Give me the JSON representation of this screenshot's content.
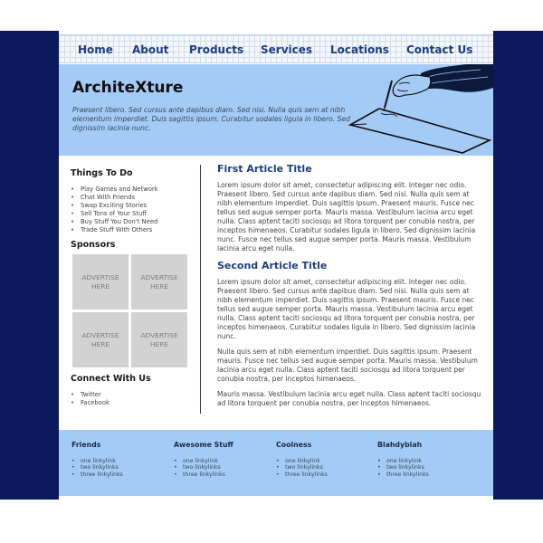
{
  "nav": {
    "items": [
      {
        "label": "Home"
      },
      {
        "label": "About"
      },
      {
        "label": "Products"
      },
      {
        "label": "Services"
      },
      {
        "label": "Locations"
      },
      {
        "label": "Contact Us"
      }
    ]
  },
  "header": {
    "title": "ArchiteXture",
    "tagline": "Praesent libero. Sed cursus ante dapibus diam. Sed nisi. Nulla quis sem at nibh elementum imperdiet. Duis sagittis ipsum. Curabitur sodales ligula in libero. Sed dignissim lacinia nunc."
  },
  "sidebar": {
    "things_heading": "Things To Do",
    "things": [
      "Play Games and Network",
      "Chat With Friends",
      "Swap Exciting Stories",
      "Sell Tons of Your Stuff",
      "Buy Stuff You Don't Need",
      "Trade Stuff With Others"
    ],
    "sponsors_heading": "Sponsors",
    "ads": [
      {
        "line1": "ADVERTISE",
        "line2": "HERE"
      },
      {
        "line1": "ADVERTISE",
        "line2": "HERE"
      },
      {
        "line1": "ADVERTISE",
        "line2": "HERE"
      },
      {
        "line1": "ADVERTISE",
        "line2": "HERE"
      }
    ],
    "connect_heading": "Connect With Us",
    "connect": [
      "Twitter",
      "Facebook"
    ]
  },
  "main": {
    "first_title": "First Article Title",
    "first_p1": "Lorem ipsum dolor sit amet, consectetur adipiscing elit. Integer nec odio. Praesent libero. Sed cursus ante dapibus diam. Sed nisi. Nulla quis sem at nibh elementum imperdiet. Duis sagittis ipsum. Praesent mauris. Fusce nec tellus sed augue semper porta. Mauris massa. Vestibulum lacinia arcu eget nulla. Class aptent taciti sociosqu ad litora torquent per conubia nostra, per inceptos himenaeos. Curabitur sodales ligula in libero. Sed dignissim lacinia nunc. Fusce nec tellus sed augue semper porta. Mauris massa. Vestibulum lacinia arcu eget nulla.",
    "second_title": "Second Article Title",
    "second_p1": "Lorem ipsum dolor sit amet, consectetur adipiscing elit. Integer nec odio. Praesent libero. Sed cursus ante dapibus diam. Sed nisi. Nulla quis sem at nibh elementum imperdiet. Duis sagittis ipsum. Praesent mauris. Fusce nec tellus sed augue semper porta. Mauris massa. Vestibulum lacinia arcu eget nulla. Class aptent taciti sociosqu ad litora torquent per conubia nostra, per inceptos himenaeos. Curabitur sodales ligula in libero. Sed dignissim lacinia nunc.",
    "second_p2": "Nulla quis sem at nibh elementum imperdiet. Duis sagittis ipsum. Praesent mauris. Fusce nec tellus sed augue semper porta. Mauris massa. Vestibulum lacinia arcu eget nulla. Class aptent taciti sociosqu ad litora torquent per conubia nostra, per inceptos himenaeos.",
    "second_p3": "Mauris massa. Vestibulum lacinia arcu eget nulla. Class aptent taciti sociosqu ad litora torquent per conubia nostra, per inceptos himenaeos."
  },
  "footer": {
    "columns": [
      {
        "heading": "Friends",
        "links": [
          "one linkylink",
          "two linkylinks",
          "three linkylinks"
        ]
      },
      {
        "heading": "Awesome Stuff",
        "links": [
          "one linkylink",
          "two linkylinks",
          "three linkylinks"
        ]
      },
      {
        "heading": "Coolness",
        "links": [
          "one linkylink",
          "two linkylinks",
          "three linkylinks"
        ]
      },
      {
        "heading": "Blahdyblah",
        "links": [
          "one linkylink",
          "two linkylinks",
          "three linkylinks"
        ]
      }
    ]
  },
  "colors": {
    "page_background": "#0b1a5c",
    "header_background": "#a3cbf5",
    "accent": "#1e3e80"
  },
  "icons": [
    "drawing-hand-illustration"
  ]
}
